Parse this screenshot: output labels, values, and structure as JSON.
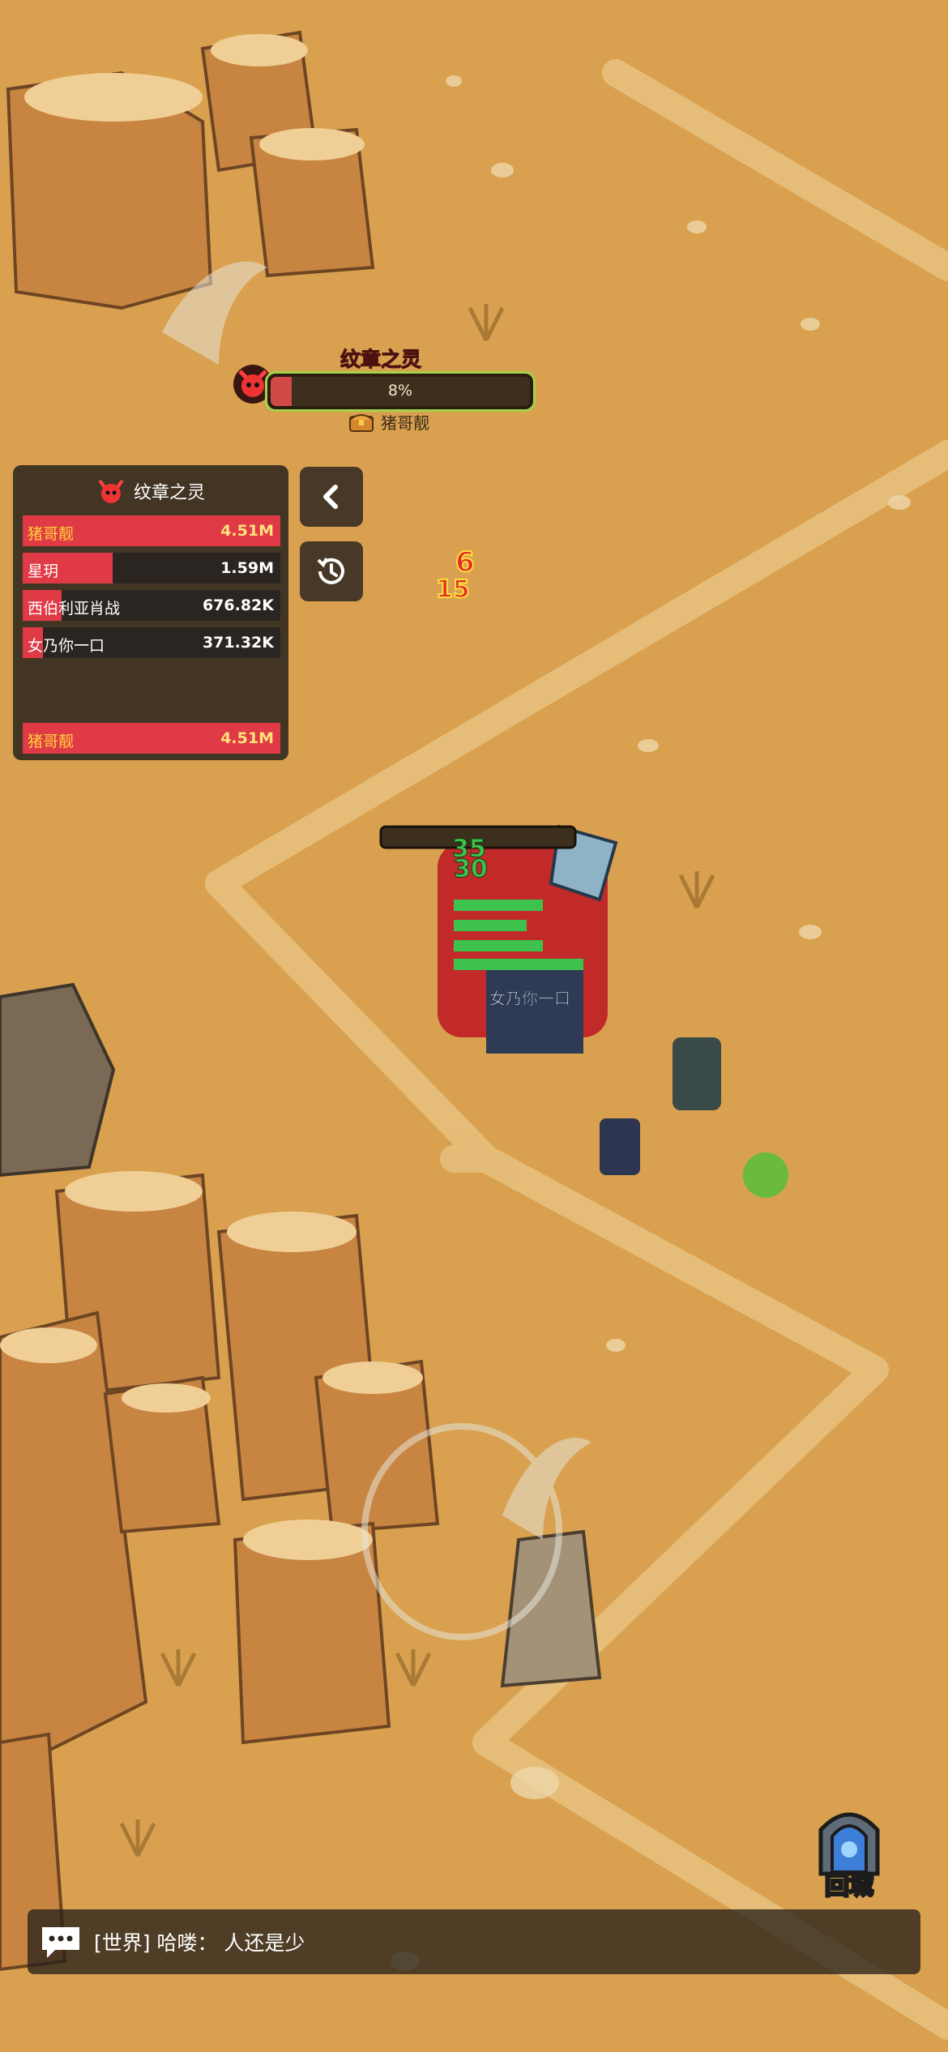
{
  "boss": {
    "name": "纹章之灵",
    "progress_percent": 8,
    "progress_label": "8%",
    "owner": "猪哥靓"
  },
  "damage_panel": {
    "title": "纹章之灵",
    "rows": [
      {
        "name": "猪哥靓",
        "value": "4.51M",
        "fill": 1.0
      },
      {
        "name": "星玥",
        "value": "1.59M",
        "fill": 0.35
      },
      {
        "name": "西伯利亚肖战",
        "value": "676.82K",
        "fill": 0.15
      },
      {
        "name": "女乃你一口",
        "value": "371.32K",
        "fill": 0.08
      }
    ],
    "me": {
      "name": "猪哥靓",
      "value": "4.51M",
      "fill": 1.0
    }
  },
  "side_buttons": {
    "collapse_icon": "chevron-left-icon",
    "history_icon": "history-icon"
  },
  "float_numbers": [
    "6",
    "15",
    "35",
    "30"
  ],
  "player_name_tag": "女乃你一口",
  "town_button": {
    "label": "回城",
    "icon": "portal-icon"
  },
  "chat": {
    "icon": "chat-bubble-icon",
    "message": "[世界] 哈喽： 人还是少"
  },
  "colors": {
    "accent": "#e03a46",
    "boss_ring": "#a4d34b",
    "my_name": "#ffcf3a"
  }
}
